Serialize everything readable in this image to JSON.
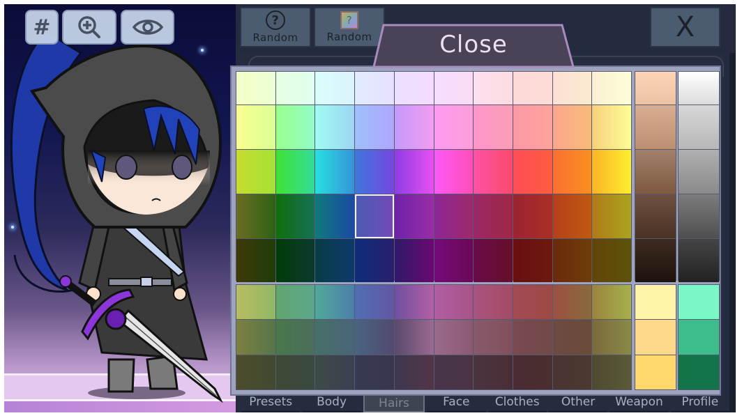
{
  "toolbar": {
    "grid_label": "#",
    "icons": [
      "grid-hash-icon",
      "zoom-in-icon",
      "eye-icon"
    ]
  },
  "menu": {
    "random_button_1": {
      "label": "Random",
      "icon": "question-circle-icon"
    },
    "random_button_2": {
      "label": "Random",
      "icon": "question-color-square-icon",
      "icon_text": "?"
    },
    "random_icon_text": "?",
    "close_x_label": "X",
    "close_tab_label": "Close"
  },
  "palette": {
    "selected": {
      "grid": "main",
      "row": 3,
      "col": 3
    },
    "main_grid": [
      [
        [
          "#f4ffc6",
          "#ecffd4"
        ],
        [
          "#e6ffe2",
          "#e0fff0"
        ],
        [
          "#d8fff9",
          "#dcf1ff"
        ],
        [
          "#e2ecff",
          "#e6e0ff"
        ],
        [
          "#ecdfff",
          "#f4dcff"
        ],
        [
          "#f6ddff",
          "#fbdcf5"
        ],
        [
          "#fde0ef",
          "#fddbe0"
        ],
        [
          "#fdd9d9",
          "#fdddd6"
        ],
        [
          "#fde0d3",
          "#fbead0"
        ],
        [
          "#fbf0d1",
          "#fcfed9"
        ]
      ],
      [
        [
          "#fbff8f",
          "#d9ff95"
        ],
        [
          "#9bff8e",
          "#93fcc7"
        ],
        [
          "#a0fbf0",
          "#9ed5f4"
        ],
        [
          "#9fc0fb",
          "#b0a6fc"
        ],
        [
          "#c39afc",
          "#f29cf0"
        ],
        [
          "#fd9bf1",
          "#fc9fd9"
        ],
        [
          "#fd96cc",
          "#fd9eb5"
        ],
        [
          "#fd98a8",
          "#fda49a"
        ],
        [
          "#fda68e",
          "#f7bc78"
        ],
        [
          "#f8d07d",
          "#fcfe94"
        ]
      ],
      [
        [
          "#c8db2e",
          "#a3e336"
        ],
        [
          "#3fe332",
          "#32dc98"
        ],
        [
          "#28e0df",
          "#3593d9"
        ],
        [
          "#3d78dc",
          "#7746e0"
        ],
        [
          "#8d3ee3",
          "#e84ff0"
        ],
        [
          "#fd59f6",
          "#fd4fb7"
        ],
        [
          "#fd51a6",
          "#fc4a6c"
        ],
        [
          "#fd4d57",
          "#fd5c40"
        ],
        [
          "#fd6f33",
          "#f7901f"
        ],
        [
          "#fcb425",
          "#fcef2e"
        ]
      ],
      [
        [
          "#6c6c22",
          "#2d6214"
        ],
        [
          "#0f6f0b",
          "#157156"
        ],
        [
          "#0e7a7c",
          "#1a4aa4"
        ],
        [
          "#4a5cb3",
          "#7349b9"
        ],
        [
          "#6e21a9",
          "#9a2ea6"
        ],
        [
          "#8e2696",
          "#9d2a6c"
        ],
        [
          "#9a2869",
          "#a02743"
        ],
        [
          "#9b2332",
          "#a92f24"
        ],
        [
          "#b4401a",
          "#c05a12"
        ],
        [
          "#b17a17",
          "#aaa420"
        ]
      ],
      [
        [
          "#3f3a08",
          "#1e3c0a"
        ],
        [
          "#003c08",
          "#0b3a2d"
        ],
        [
          "#063d46",
          "#0f3a6c"
        ],
        [
          "#0c2d7a",
          "#2b1f6c"
        ],
        [
          "#2e1a6a",
          "#6c0870"
        ],
        [
          "#760a7b",
          "#6a0856"
        ],
        [
          "#6a0a49",
          "#65102a"
        ],
        [
          "#6b0e11",
          "#6b1a0d"
        ],
        [
          "#6a2a0a",
          "#6e3d0a"
        ],
        [
          "#624508",
          "#5c5309"
        ]
      ]
    ],
    "skin_column": [
      [
        "#fdd4b6",
        "#ecc2a3"
      ],
      [
        "#d9ad91",
        "#bd9072"
      ],
      [
        "#a3806b",
        "#7d5940"
      ],
      [
        "#6f5141",
        "#4a3224"
      ],
      [
        "#3d2b20",
        "#1d130c"
      ]
    ],
    "gray_column": [
      [
        "#ffffff",
        "#dcdcdc"
      ],
      [
        "#d7d7d7",
        "#b7b7b7"
      ],
      [
        "#b0b0b0",
        "#8a8a8a"
      ],
      [
        "#7c7c7c",
        "#4f4f4f"
      ],
      [
        "#454545",
        "#222222"
      ]
    ],
    "muted_grid": [
      [
        [
          "#b9bd5f",
          "#8fb866"
        ],
        [
          "#62a66e",
          "#5aa68c"
        ],
        [
          "#51a89a",
          "#4c7fa9"
        ],
        [
          "#4f6fb2",
          "#6556a4"
        ],
        [
          "#704f9f",
          "#b460a6"
        ],
        [
          "#b25ea4",
          "#a75488"
        ],
        [
          "#a85480",
          "#a34a64"
        ],
        [
          "#a34a55",
          "#9c4a44"
        ],
        [
          "#9c5040",
          "#8a6a3e"
        ],
        [
          "#99843e",
          "#a6b04c"
        ]
      ],
      [
        [
          "#7d8040",
          "#55764a"
        ],
        [
          "#4a784a",
          "#4a6e5c"
        ],
        [
          "#467068",
          "#4a6478"
        ],
        [
          "#4a6482",
          "#514a6e"
        ],
        [
          "#5a4a6c",
          "#9a6a92"
        ],
        [
          "#9a6a8c",
          "#8a5a72"
        ],
        [
          "#885a6a",
          "#80505c"
        ],
        [
          "#7a4a50",
          "#704a48"
        ],
        [
          "#6e4a44",
          "#6a4c38"
        ],
        [
          "#7a6a3c",
          "#8a8a48"
        ]
      ],
      [
        [
          "#4f4c2c",
          "#3f4a30"
        ],
        [
          "#3c4a34",
          "#3a4a40"
        ],
        [
          "#3c4a48",
          "#3a4250"
        ],
        [
          "#363a52",
          "#3a364e"
        ],
        [
          "#3e3650",
          "#523646"
        ],
        [
          "#48344a",
          "#4a3444"
        ],
        [
          "#4a3440",
          "#4a2e36"
        ],
        [
          "#4a2c32",
          "#4a2e30"
        ],
        [
          "#4a3430",
          "#4a3a30"
        ],
        [
          "#4e4a30",
          "#5a5a38"
        ]
      ]
    ],
    "yellow_column": [
      "#fff5a8",
      "#ffd98a",
      "#ffd76a"
    ],
    "green_column": [
      "#7af7c6",
      "#3ebd8c",
      "#12754a"
    ]
  },
  "tabs": [
    {
      "label": "Presets",
      "active": false
    },
    {
      "label": "Body",
      "active": false
    },
    {
      "label": "Hairs",
      "active": true
    },
    {
      "label": "Face",
      "active": false
    },
    {
      "label": "Clothes",
      "active": false
    },
    {
      "label": "Other",
      "active": false
    },
    {
      "label": "Weapon",
      "active": false
    },
    {
      "label": "Profile",
      "active": false
    }
  ],
  "colors": {
    "panel_bg": "#9ea3c0",
    "close_tab_fill": "#4a4256",
    "close_tab_border": "#a88cbf",
    "button_bg": "#4b5b70"
  }
}
